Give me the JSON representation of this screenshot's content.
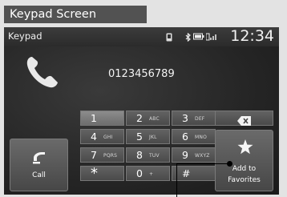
{
  "caption": "Keypad Screen",
  "status_bar": {
    "title": "Keypad",
    "time": "12:34"
  },
  "dialed_number": "0123456789",
  "keys": [
    {
      "digit": "1",
      "letters": ""
    },
    {
      "digit": "2",
      "letters": "ABC"
    },
    {
      "digit": "3",
      "letters": "DEF"
    },
    {
      "digit": "4",
      "letters": "GHI"
    },
    {
      "digit": "5",
      "letters": "JKL"
    },
    {
      "digit": "6",
      "letters": "MNO"
    },
    {
      "digit": "7",
      "letters": "PQRS"
    },
    {
      "digit": "8",
      "letters": "TUV"
    },
    {
      "digit": "9",
      "letters": "WXYZ"
    },
    {
      "digit": "*",
      "letters": ""
    },
    {
      "digit": "0",
      "letters": "+"
    },
    {
      "digit": "#",
      "letters": ""
    }
  ],
  "buttons": {
    "call": "Call",
    "add_fav_line1": "Add to",
    "add_fav_line2": "Favorites"
  },
  "icons": [
    "handset-icon",
    "phone-status-icon",
    "bluetooth-icon",
    "battery-icon",
    "signal-icon",
    "backspace-icon",
    "call-icon",
    "star-icon"
  ]
}
